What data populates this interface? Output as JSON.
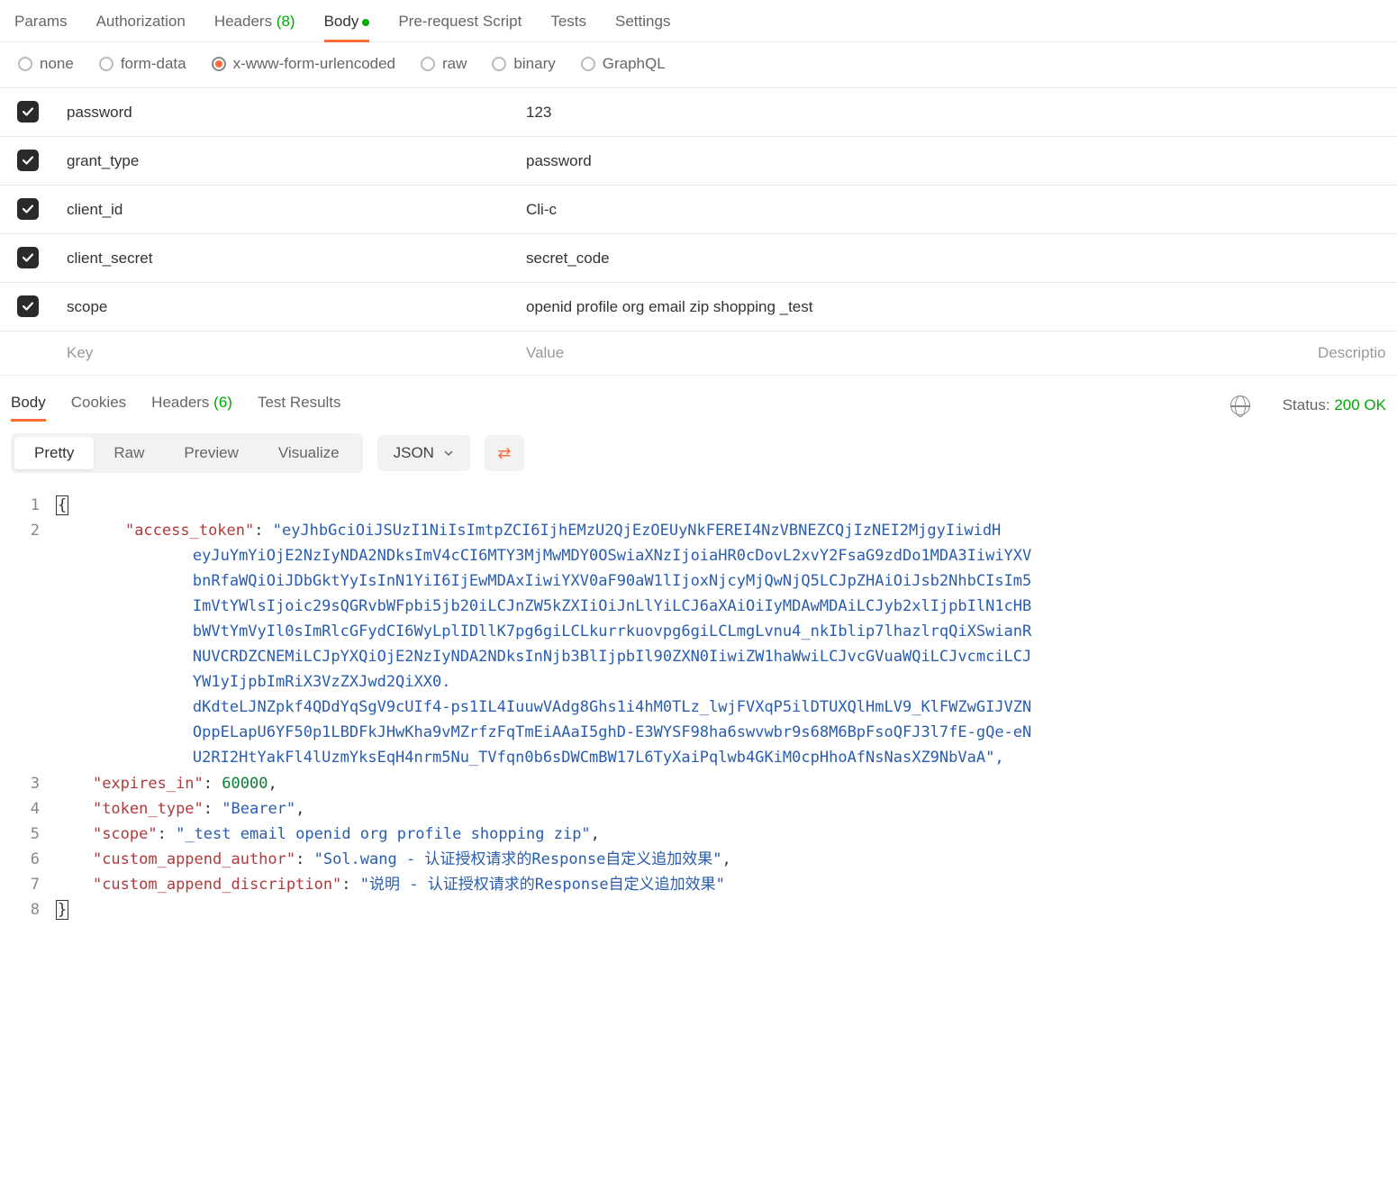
{
  "request_tabs": [
    {
      "label": "Params"
    },
    {
      "label": "Authorization"
    },
    {
      "label": "Headers",
      "count": "(8)"
    },
    {
      "label": "Body",
      "active": true,
      "dot": true
    },
    {
      "label": "Pre-request Script"
    },
    {
      "label": "Tests"
    },
    {
      "label": "Settings"
    }
  ],
  "body_types": [
    {
      "label": "none"
    },
    {
      "label": "form-data"
    },
    {
      "label": "x-www-form-urlencoded",
      "selected": true
    },
    {
      "label": "raw"
    },
    {
      "label": "binary"
    },
    {
      "label": "GraphQL"
    }
  ],
  "params": [
    {
      "key": "password",
      "value": "123"
    },
    {
      "key": "grant_type",
      "value": "password"
    },
    {
      "key": "client_id",
      "value": "Cli-c"
    },
    {
      "key": "client_secret",
      "value": "secret_code"
    },
    {
      "key": "scope",
      "value": "openid profile org email zip shopping _test"
    }
  ],
  "placeholders": {
    "key": "Key",
    "value": "Value",
    "desc": "Descriptio"
  },
  "response_tabs": [
    {
      "label": "Body",
      "active": true
    },
    {
      "label": "Cookies"
    },
    {
      "label": "Headers",
      "count": "(6)"
    },
    {
      "label": "Test Results"
    }
  ],
  "status": {
    "label": "Status:",
    "value": "200 OK"
  },
  "view_tabs": [
    "Pretty",
    "Raw",
    "Preview",
    "Visualize"
  ],
  "view_active": "Pretty",
  "format": "JSON",
  "json_body": {
    "access_token_head": "\"access_token\"",
    "access_token_lines": [
      "\"eyJhbGciOiJSUzI1NiIsImtpZCI6IjhEMzU2QjEzOEUyNkFEREI4NzVBNEZCQjIzNEI2MjgyIiwidH",
      "eyJuYmYiOjE2NzIyNDA2NDksImV4cCI6MTY3MjMwMDY0OSwiaXNzIjoiaHR0cDovL2xvY2FsaG9zdDo1MDA3IiwiYXV",
      "bnRfaWQiOiJDbGktYyIsInN1YiI6IjEwMDAxIiwiYXV0aF90aW1lIjoxNjcyMjQwNjQ5LCJpZHAiOiJsb2NhbCIsIm5",
      "ImVtYWlsIjoic29sQGRvbWFpbi5jb20iLCJnZW5kZXIiOiJnLlYiLCJ6aXAiOiIyMDAwMDAiLCJyb2xlIjpbIlN1cHB",
      "bWVtYmVyIl0sImRlcGFydCI6WyLplIDllK7pg6giLCLkurrkuovpg6giLCLmgLvnu4_nkIblip7lhazlrqQiXSwianR",
      "NUVCRDZCNEMiLCJpYXQiOjE2NzIyNDA2NDksInNjb3BlIjpbIl90ZXN0IiwiZW1haWwiLCJvcGVuaWQiLCJvcmciLCJ",
      "YW1yIjpbImRiX3VzZXJwd2QiXX0.",
      "dKdteLJNZpkf4QDdYqSgV9cUIf4-ps1IL4IuuwVAdg8Ghs1i4hM0TLz_lwjFVXqP5ilDTUXQlHmLV9_KlFWZwGIJVZN",
      "OppELapU6YF50p1LBDFkJHwKha9vMZrfzFqTmEiAAaI5ghD-E3WYSF98ha6swvwbr9s68M6BpFsoQFJ3l7fE-gQe-eN",
      "U2RI2HtYakFl4lUzmYksEqH4nrm5Nu_TVfqn0b6sDWCmBW17L6TyXaiPqlwb4GKiM0cpHhoAfNsNasXZ9NbVaA\","
    ],
    "expires_in": {
      "k": "\"expires_in\"",
      "v": "60000"
    },
    "token_type": {
      "k": "\"token_type\"",
      "v": "\"Bearer\""
    },
    "scope": {
      "k": "\"scope\"",
      "v": "\"_test email openid org profile shopping zip\""
    },
    "author": {
      "k": "\"custom_append_author\"",
      "v": "\"Sol.wang - 认证授权请求的Response自定义追加效果\""
    },
    "discription": {
      "k": "\"custom_append_discription\"",
      "v": "\"说明 - 认证授权请求的Response自定义追加效果\""
    }
  }
}
